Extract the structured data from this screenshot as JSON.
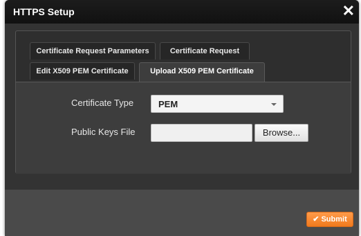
{
  "dialog": {
    "title": "HTTPS Setup",
    "close_glyph": "✕"
  },
  "tabs": [
    {
      "label": "Certificate Request Parameters",
      "active": false
    },
    {
      "label": "Certificate Request",
      "active": false
    },
    {
      "label": "Edit X509 PEM Certificate",
      "active": false
    },
    {
      "label": "Upload X509 PEM Certificate",
      "active": true
    }
  ],
  "form": {
    "certificate_type_label": "Certificate Type",
    "certificate_type_value": "PEM",
    "public_keys_label": "Public Keys File",
    "public_keys_value": "",
    "browse_label": "Browse..."
  },
  "footer": {
    "submit_label": "Submit",
    "submit_icon": "check-icon"
  },
  "colors": {
    "accent": "#f28a2e",
    "titlebar": "#151515",
    "panel": "#3d3d3d"
  }
}
